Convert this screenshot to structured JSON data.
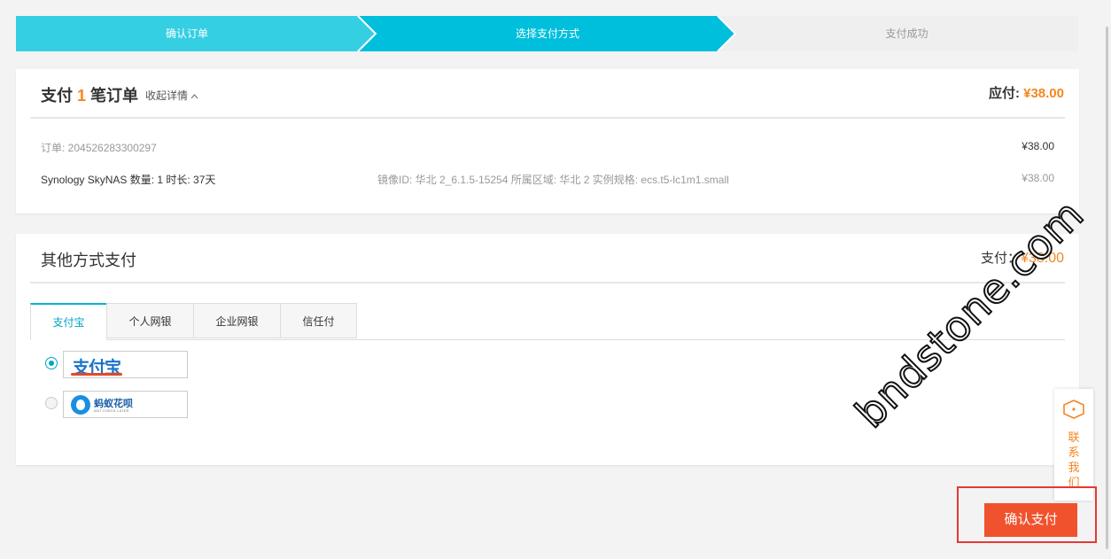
{
  "steps": [
    {
      "label": "确认订单",
      "state": "done"
    },
    {
      "label": "选择支付方式",
      "state": "current"
    },
    {
      "label": "支付成功",
      "state": "pending"
    }
  ],
  "colors": {
    "accent": "#00b3d6",
    "price": "#f5861f",
    "confirm": "#f0522d"
  },
  "order_summary": {
    "title_prefix": "支付",
    "count": "1",
    "title_suffix": "笔订单",
    "toggle_label": "收起详情",
    "toggle_icon": "chevron-up-icon",
    "due_label": "应付:",
    "due_amount": "¥38.00",
    "order_id": "订单: 204526283300297",
    "order_amount": "¥38.00",
    "product": "Synology SkyNAS 数量: 1 时长: 37天",
    "spec": "镜像ID: 华北 2_6.1.5-15254 所属区域: 华北 2 实例规格: ecs.t5-lc1m1.small",
    "product_amount": "¥38.00"
  },
  "other_payment": {
    "title": "其他方式支付",
    "total_label": "支付：",
    "total_amount": "¥38.00",
    "tabs": [
      {
        "label": "支付宝",
        "active": true
      },
      {
        "label": "个人网银",
        "active": false
      },
      {
        "label": "企业网银",
        "active": false
      },
      {
        "label": "信任付",
        "active": false
      }
    ],
    "options": [
      {
        "name": "支付宝",
        "checked": true
      },
      {
        "name": "蚂蚁花呗",
        "sub": "ANT CHECK LATER",
        "checked": false
      }
    ]
  },
  "contact": {
    "label": "联系我们",
    "icon": "chat-hexagon-icon"
  },
  "confirm_button": "确认支付",
  "watermark": "bndstone.com"
}
